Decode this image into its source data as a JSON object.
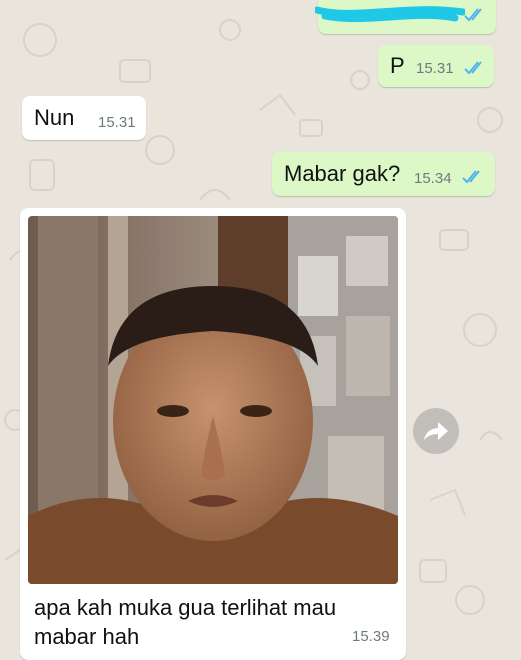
{
  "chat": {
    "messages": [
      {
        "id": "m1",
        "direction": "outgoing",
        "text": "",
        "time": "",
        "status": "read",
        "note": "redacted"
      },
      {
        "id": "m2",
        "direction": "outgoing",
        "text": "P",
        "time": "15.31",
        "status": "read"
      },
      {
        "id": "m3",
        "direction": "incoming",
        "text": "Nun",
        "time": "15.31"
      },
      {
        "id": "m4",
        "direction": "outgoing",
        "text": "Mabar gak?",
        "time": "15.34",
        "status": "read"
      },
      {
        "id": "m5",
        "direction": "incoming",
        "type": "image",
        "caption": "apa kah muka gua terlihat mau mabar hah",
        "time": "15.39"
      }
    ]
  },
  "icons": {
    "read_receipt": "double-check-icon",
    "forward": "forward-arrow-icon"
  },
  "colors": {
    "outgoing_bubble": "#dcf8c6",
    "incoming_bubble": "#ffffff",
    "read_tick": "#4fb6ec",
    "background": "#e9e4dc",
    "redaction": "#1ec8e6"
  }
}
